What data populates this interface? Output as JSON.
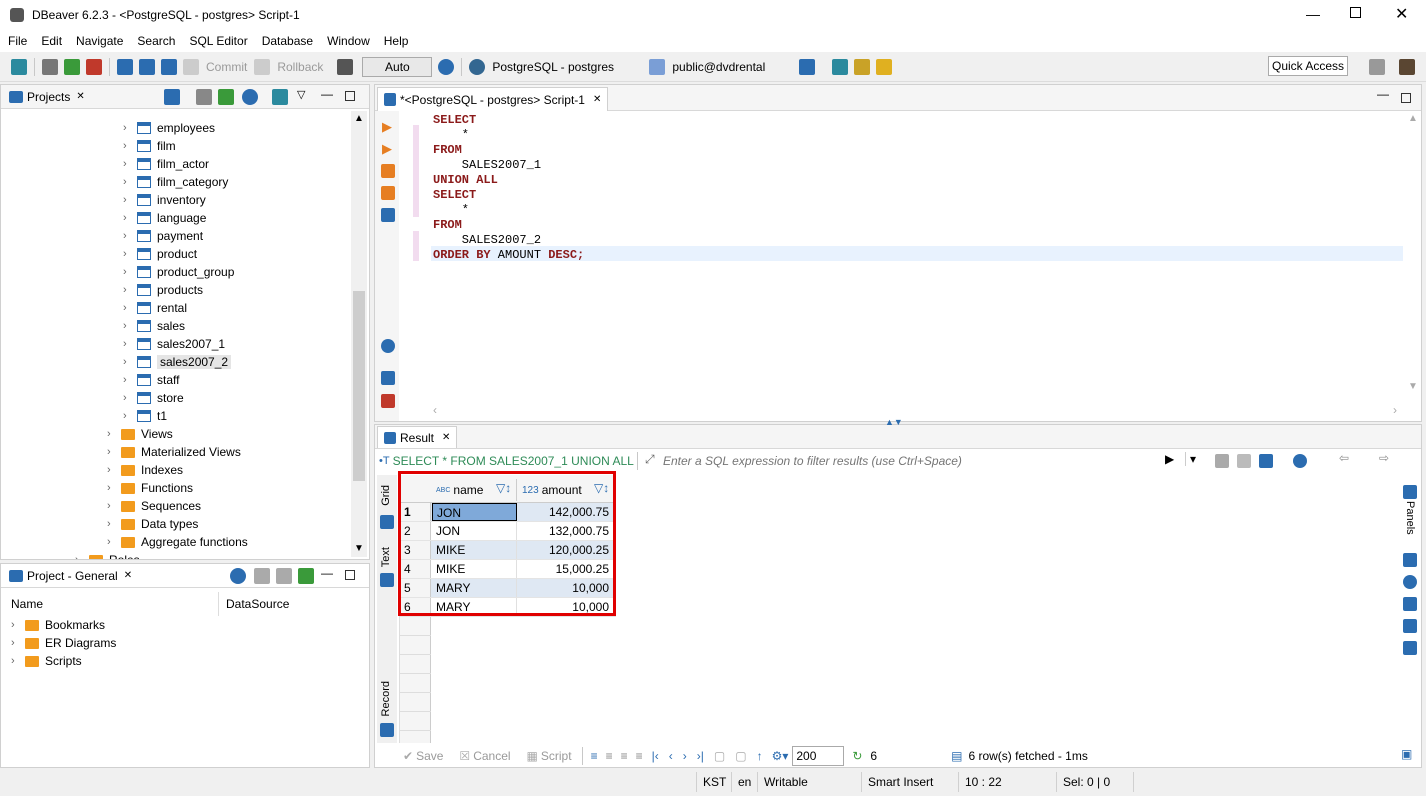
{
  "window": {
    "title": "DBeaver 6.2.3 - <PostgreSQL - postgres> Script-1"
  },
  "menu": [
    "File",
    "Edit",
    "Navigate",
    "Search",
    "SQL Editor",
    "Database",
    "Window",
    "Help"
  ],
  "toolbar": {
    "commit": "Commit",
    "rollback": "Rollback",
    "mode": "Auto",
    "connection": "PostgreSQL - postgres",
    "schema": "public@dvdrental",
    "quick_access": "Quick Access"
  },
  "projects": {
    "tab": "Projects",
    "tables": [
      "employees",
      "film",
      "film_actor",
      "film_category",
      "inventory",
      "language",
      "payment",
      "product",
      "product_group",
      "products",
      "rental",
      "sales",
      "sales2007_1",
      "sales2007_2",
      "staff",
      "store",
      "t1"
    ],
    "selected": "sales2007_2",
    "folders": [
      "Views",
      "Materialized Views",
      "Indexes",
      "Functions",
      "Sequences",
      "Data types",
      "Aggregate functions"
    ],
    "roles": "Roles"
  },
  "project_general": {
    "tab": "Project - General",
    "col_name": "Name",
    "col_ds": "DataSource",
    "items": [
      "Bookmarks",
      "ER Diagrams",
      "Scripts"
    ]
  },
  "editor": {
    "tab": "*<PostgreSQL - postgres> Script-1",
    "lines": [
      {
        "kw": "SELECT",
        "rest": ""
      },
      {
        "kw": "",
        "rest": "    *"
      },
      {
        "kw": "FROM",
        "rest": ""
      },
      {
        "kw": "",
        "rest": "    SALES2007_1"
      },
      {
        "kw": "UNION ALL",
        "rest": ""
      },
      {
        "kw": "SELECT",
        "rest": ""
      },
      {
        "kw": "",
        "rest": "    *"
      },
      {
        "kw": "FROM",
        "rest": ""
      },
      {
        "kw": "",
        "rest": "    SALES2007_2"
      },
      {
        "kw": "ORDER BY",
        "rest": " AMOUNT ",
        "kw2": "DESC",
        ";": ";"
      }
    ]
  },
  "result": {
    "tab": "Result",
    "query": "SELECT * FROM SALES2007_1 UNION ALL",
    "filter_placeholder": "Enter a SQL expression to filter results (use Ctrl+Space)",
    "vtabs": {
      "grid": "Grid",
      "text": "Text",
      "record": "Record",
      "panels": "Panels"
    },
    "columns": [
      {
        "type": "ABC",
        "name": "name"
      },
      {
        "type": "123",
        "name": "amount"
      }
    ],
    "rows": [
      {
        "n": "1",
        "name": "JON",
        "amount": "142,000.75"
      },
      {
        "n": "2",
        "name": "JON",
        "amount": "132,000.75"
      },
      {
        "n": "3",
        "name": "MIKE",
        "amount": "120,000.25"
      },
      {
        "n": "4",
        "name": "MIKE",
        "amount": "15,000.25"
      },
      {
        "n": "5",
        "name": "MARY",
        "amount": "10,000"
      },
      {
        "n": "6",
        "name": "MARY",
        "amount": "10,000"
      }
    ],
    "bottom": {
      "save": "Save",
      "cancel": "Cancel",
      "script": "Script",
      "fetch_size": "200",
      "count": "6",
      "fetched": "6 row(s) fetched - 1ms"
    }
  },
  "status": {
    "tz": "KST",
    "lang": "en",
    "mode": "Writable",
    "insert": "Smart Insert",
    "pos": "10 : 22",
    "sel": "Sel: 0 | 0"
  },
  "colors": {
    "keyword": "#8b1a1a",
    "highlight": "#e00000",
    "accent": "#2b6cb0"
  }
}
